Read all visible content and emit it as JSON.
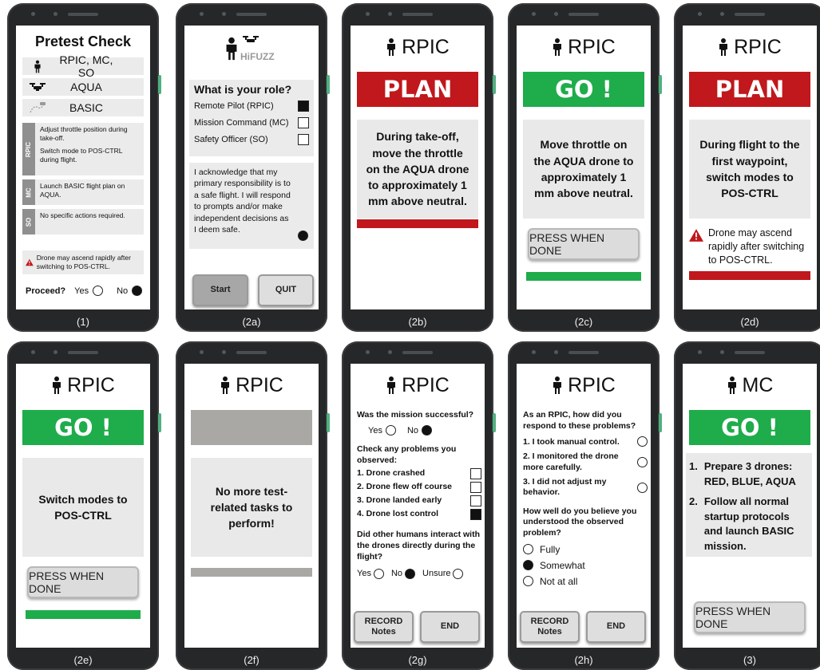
{
  "icons": {
    "person": "person-icon",
    "drone": "drone-icon",
    "small_drone": "small-drone-icon",
    "warning": "warning-triangle-icon"
  },
  "colors": {
    "plan_red": "#c0181c",
    "go_green": "#1fac4b",
    "phone_body": "#262729"
  },
  "p1": {
    "caption": "(1)",
    "title": "Pretest Check",
    "roles": "RPIC, MC, SO",
    "drone": "AQUA",
    "plan": "BASIC",
    "rpic_label": "RPIC",
    "rpic_line1": "Adjust throttle position during take-off.",
    "rpic_line2": "Switch mode to POS-CTRL during flight.",
    "mc_label": "MC",
    "mc_text": "Launch BASIC flight plan on AQUA.",
    "so_label": "SO",
    "so_text": "No specific actions required.",
    "warning": "Drone may ascend rapidly after switching to POS-CTRL.",
    "proceed": "Proceed?",
    "yes": "Yes",
    "no": "No"
  },
  "p2a": {
    "caption": "(2a)",
    "logo": "HiFUZZ",
    "question": "What is your role?",
    "opt1": "Remote Pilot (RPIC)",
    "opt2": "Mission Command (MC)",
    "opt3": "Safety Officer (SO)",
    "ack": "I acknowledge that my primary responsibility is to a safe flight.  I will respond to prompts  and/or make independent decisions as I deem safe.",
    "start": "Start",
    "quit": "QUIT"
  },
  "p2b": {
    "caption": "(2b)",
    "role": "RPIC",
    "banner": "PLAN",
    "text": "During take-off, move the throttle on the AQUA drone to approximately 1 mm above neutral."
  },
  "p2c": {
    "caption": "(2c)",
    "role": "RPIC",
    "banner": "GO !",
    "text": "Move throttle on the AQUA drone to approximately 1 mm above neutral.",
    "button": "PRESS WHEN DONE"
  },
  "p2d": {
    "caption": "(2d)",
    "role": "RPIC",
    "banner": "PLAN",
    "text": "During flight to the first waypoint, switch modes to POS-CTRL",
    "warning": "Drone may ascend rapidly after switching to POS-CTRL."
  },
  "p2e": {
    "caption": "(2e)",
    "role": "RPIC",
    "banner": "GO !",
    "text": "Switch modes to POS-CTRL",
    "button": "PRESS WHEN DONE"
  },
  "p2f": {
    "caption": "(2f)",
    "role": "RPIC",
    "text": "No more test-related tasks to perform!"
  },
  "p2g": {
    "caption": "(2g)",
    "role": "RPIC",
    "q1": "Was the mission successful?",
    "yes": "Yes",
    "no": "No",
    "q2": "Check any problems you observed:",
    "problems": [
      "1.  Drone crashed",
      "2.  Drone flew off course",
      "3.  Drone landed early",
      "4.  Drone lost control"
    ],
    "q3": "Did other humans interact with the drones directly during the flight?",
    "unsure": "Unsure",
    "record": "RECORD Notes",
    "end": "END"
  },
  "p2h": {
    "caption": "(2h)",
    "role": "RPIC",
    "q1": "As an RPIC, how did you respond to these problems?",
    "a1": "1.  I took manual control.",
    "a2": "2.  I monitored the drone more carefully.",
    "a3": "3.  I did not adjust my behavior.",
    "q2": "How well do you believe you understood the observed problem?",
    "o1": "Fully",
    "o2": "Somewhat",
    "o3": "Not at all",
    "record": "RECORD Notes",
    "end": "END"
  },
  "p3": {
    "caption": "(3)",
    "role": "MC",
    "banner": "GO !",
    "step1": "Prepare 3 drones: RED, BLUE, AQUA",
    "step2": "Follow all normal startup protocols and launch BASIC mission.",
    "n1": "1.",
    "n2": "2.",
    "button": "PRESS WHEN DONE"
  }
}
